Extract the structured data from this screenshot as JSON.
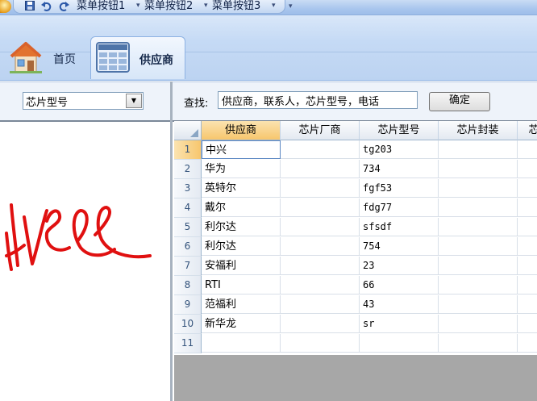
{
  "quick_access": {
    "menu_buttons": [
      "菜单按钮1",
      "菜单按钮2",
      "菜单按钮3"
    ],
    "icons": [
      "save-icon",
      "undo-icon",
      "redo-icon",
      "customize-dropdown-icon"
    ]
  },
  "ribbon": {
    "tabs": [
      {
        "label": "首页",
        "icon": "house-icon"
      },
      {
        "label": "供应商",
        "icon": "table-icon",
        "active": true
      }
    ]
  },
  "left_filter": {
    "combo_value": "芯片型号"
  },
  "search": {
    "label": "查找:",
    "value": "供应商，联系人，芯片型号，电话",
    "confirm_label": "确定"
  },
  "grid": {
    "columns": [
      "供应商",
      "芯片厂商",
      "芯片型号",
      "芯片封装",
      "芯"
    ],
    "rows": [
      {
        "num": "1",
        "supplier": "中兴",
        "maker": "",
        "model": "tg203",
        "package": ""
      },
      {
        "num": "2",
        "supplier": "华为",
        "maker": "",
        "model": "734",
        "package": ""
      },
      {
        "num": "3",
        "supplier": "英特尔",
        "maker": "",
        "model": "fgf53",
        "package": ""
      },
      {
        "num": "4",
        "supplier": "戴尔",
        "maker": "",
        "model": "fdg77",
        "package": ""
      },
      {
        "num": "5",
        "supplier": "利尔达",
        "maker": "",
        "model": "sfsdf",
        "package": ""
      },
      {
        "num": "6",
        "supplier": "利尔达",
        "maker": "",
        "model": "754",
        "package": ""
      },
      {
        "num": "7",
        "supplier": "安福利",
        "maker": "",
        "model": "23",
        "package": ""
      },
      {
        "num": "8",
        "supplier": "RTI",
        "maker": "",
        "model": "66",
        "package": ""
      },
      {
        "num": "9",
        "supplier": "范福利",
        "maker": "",
        "model": "43",
        "package": ""
      },
      {
        "num": "10",
        "supplier": "新华龙",
        "maker": "",
        "model": "sr",
        "package": ""
      },
      {
        "num": "11",
        "supplier": "",
        "maker": "",
        "model": "",
        "package": ""
      }
    ]
  },
  "colors": {
    "ribbon_bg": "#c5daf5",
    "active_header": "#f7c66d",
    "annotation_red": "#e01010"
  }
}
